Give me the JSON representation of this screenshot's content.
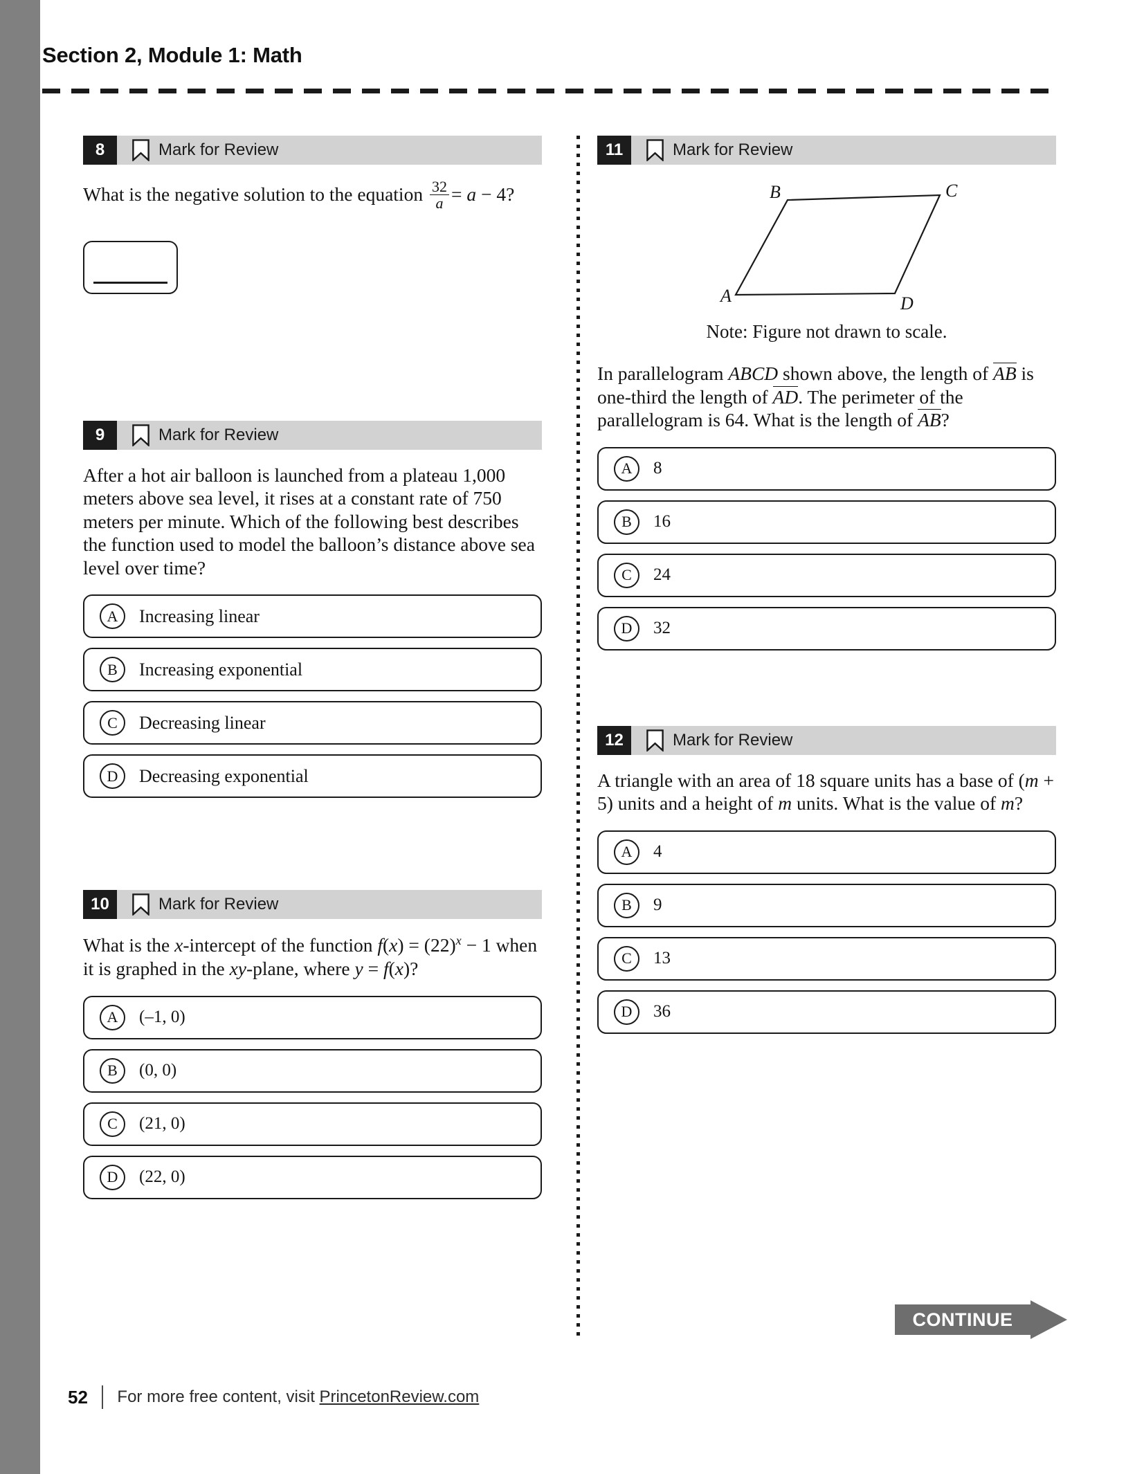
{
  "page": {
    "section_title": "Section 2, Module 1: Math",
    "page_number": "52",
    "footer_text": "For more free content, visit ",
    "footer_link": "PrincetonReview.com",
    "continue_label": "CONTINUE",
    "mark_for_review_label": "Mark for Review",
    "colors": {
      "margin_bar": "#808080",
      "header_bar": "#d2d2d2",
      "number_badge": "#1c1c1c",
      "continue_button": "#6e6e6e",
      "text": "#141414"
    }
  },
  "questions": [
    {
      "number": "8",
      "mark_label": "Mark for Review",
      "type": "student-produced-response",
      "prompt_prefix": "What is the negative solution to the equation ",
      "fraction_numerator": "32",
      "fraction_denominator": "a",
      "prompt_middle": "=",
      "prompt_var": "a",
      "prompt_minus": "− 4",
      "prompt_suffix": "?",
      "answer_value": ""
    },
    {
      "number": "9",
      "mark_label": "Mark for Review",
      "type": "multiple-choice",
      "prompt_line1": "After a hot air balloon is launched from a plateau",
      "prompt_num1": "1,000",
      "prompt_line2": " meters above sea level, it rises at a constant rate",
      "prompt_line3": "of ",
      "prompt_num2": "750",
      "prompt_line4": " meters per minute. Which of the following best describes the function used to model the balloon’s distance above sea level over time?",
      "choices": [
        {
          "letter": "A",
          "text": "Increasing linear"
        },
        {
          "letter": "B",
          "text": "Increasing exponential"
        },
        {
          "letter": "C",
          "text": "Decreasing linear"
        },
        {
          "letter": "D",
          "text": "Decreasing exponential"
        }
      ]
    },
    {
      "number": "10",
      "mark_label": "Mark for Review",
      "type": "multiple-choice",
      "prompt_part1": "What is the ",
      "prompt_var1": "x",
      "prompt_part2": "-intercept of the function ",
      "prompt_func": "f",
      "prompt_part3": "(",
      "prompt_var2": "x",
      "prompt_part4": ") = (22)",
      "prompt_exp": "x",
      "prompt_part5": " − 1 when it is graphed in the ",
      "prompt_var3": "xy",
      "prompt_part6": "-plane, where ",
      "prompt_var4": "y",
      "prompt_part7": " = ",
      "prompt_func2": "f",
      "prompt_part8": "(",
      "prompt_var5": "x",
      "prompt_part9": ")?",
      "choices": [
        {
          "letter": "A",
          "text": "(–1, 0)"
        },
        {
          "letter": "B",
          "text": "(0, 0)"
        },
        {
          "letter": "C",
          "text": "(21, 0)"
        },
        {
          "letter": "D",
          "text": "(22, 0)"
        }
      ]
    },
    {
      "number": "11",
      "mark_label": "Mark for Review",
      "type": "multiple-choice-with-figure",
      "figure": {
        "kind": "parallelogram",
        "vertex_labels": [
          "A",
          "B",
          "C",
          "D"
        ],
        "note": "Note: Figure not drawn to scale."
      },
      "prompt_part1": "In parallelogram ",
      "prompt_shape": "ABCD",
      "prompt_part2": " shown above, the length of ",
      "prompt_seg1": "AB",
      "prompt_part3": " is one-third the length of ",
      "prompt_seg2": "AD",
      "prompt_part4": ". The perimeter of the parallelogram is ",
      "prompt_perimeter": "64",
      "prompt_part5": ". What is the length of ",
      "prompt_seg3": "AB",
      "prompt_part6": "?",
      "choices": [
        {
          "letter": "A",
          "text": "8"
        },
        {
          "letter": "B",
          "text": "16"
        },
        {
          "letter": "C",
          "text": "24"
        },
        {
          "letter": "D",
          "text": "32"
        }
      ]
    },
    {
      "number": "12",
      "mark_label": "Mark for Review",
      "type": "multiple-choice",
      "prompt_part1": "A triangle with an area of ",
      "prompt_area": "18",
      "prompt_part2": " square units has a base of (",
      "prompt_var1": "m",
      "prompt_part3": " + 5) units and a height of ",
      "prompt_var2": "m",
      "prompt_part4": " units. What is the value of ",
      "prompt_var3": "m",
      "prompt_part5": "?",
      "choices": [
        {
          "letter": "A",
          "text": "4"
        },
        {
          "letter": "B",
          "text": "9"
        },
        {
          "letter": "C",
          "text": "13"
        },
        {
          "letter": "D",
          "text": "36"
        }
      ]
    }
  ]
}
